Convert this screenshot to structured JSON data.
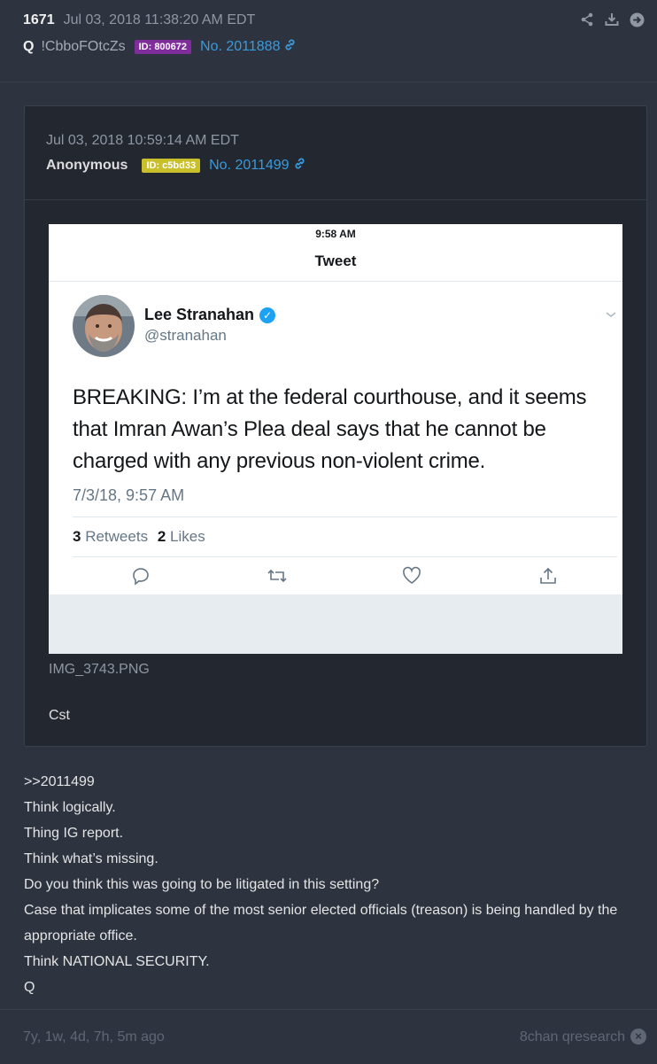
{
  "post": {
    "number": "1671",
    "date": "Jul 03, 2018 11:38:20 AM EDT",
    "author": "Q",
    "tripcode": "!CbboFOtcZs",
    "id_badge": "ID: 800672",
    "post_no": "No. 2011888",
    "actions": [
      "share-icon",
      "download-icon",
      "next-arrow-icon"
    ]
  },
  "quoted": {
    "date": "Jul 03, 2018 10:59:14 AM EDT",
    "author": "Anonymous",
    "id_badge": "ID: c5bd33",
    "post_no": "No. 2011499",
    "image": {
      "status_time": "9:58 AM",
      "title": "Tweet",
      "name": "Lee Stranahan",
      "handle": "@stranahan",
      "text": "BREAKING: I’m at the federal courthouse, and it seems that Imran Awan’s Plea deal says that he cannot be charged with any previous non-violent crime.",
      "timestamp": "7/3/18, 9:57 AM",
      "retweets_count": "3",
      "retweets_label": "Retweets",
      "likes_count": "2",
      "likes_label": "Likes"
    },
    "filename": "IMG_3743.PNG",
    "caption": "Cst"
  },
  "body": {
    "lines": [
      ">>2011499",
      "Think logically.",
      "Thing IG report.",
      "Think what’s missing.",
      "Do you think this was going to be litigated in this setting?",
      "Case that implicates some of the most senior elected officials (treason) is being handled by the appropriate office.",
      "Think NATIONAL SECURITY.",
      "Q"
    ]
  },
  "footer": {
    "ago": "7y, 1w, 4d, 7h, 5m ago",
    "source": "8chan qresearch"
  },
  "colors": {
    "background": "#2d3440",
    "link": "#3a9bdc",
    "id_purple": "#7e2d9b",
    "id_yellow": "#c9bf2a",
    "verified": "#1da1f2"
  }
}
